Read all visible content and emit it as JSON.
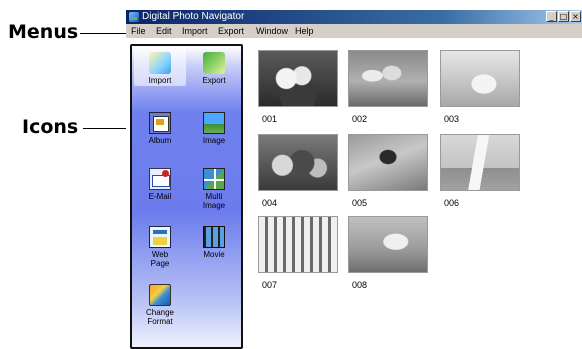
{
  "callouts": {
    "menus": "Menus",
    "icons": "Icons"
  },
  "window": {
    "title": "Digital Photo Navigator",
    "buttons": {
      "minimize": "_",
      "maximize": "□",
      "close": "×"
    }
  },
  "menubar": [
    {
      "label": "File"
    },
    {
      "label": "Edit"
    },
    {
      "label": "Import"
    },
    {
      "label": "Export"
    },
    {
      "label": "Window"
    },
    {
      "label": "Help"
    }
  ],
  "panel": {
    "items": [
      {
        "label": "Import",
        "icon": "import-icon"
      },
      {
        "label": "Export",
        "icon": "export-icon"
      },
      {
        "label": "Album",
        "icon": "album-icon"
      },
      {
        "label": "Image",
        "icon": "image-icon"
      },
      {
        "label": "E-Mail",
        "icon": "email-icon"
      },
      {
        "label": "Multi\nImage",
        "icon": "multi-image-icon"
      },
      {
        "label": "Web\nPage",
        "icon": "web-page-icon"
      },
      {
        "label": "Movie",
        "icon": "movie-icon"
      },
      {
        "label": "Change\nFormat",
        "icon": "change-format-icon"
      }
    ]
  },
  "thumbnails": [
    {
      "label": "001"
    },
    {
      "label": "002"
    },
    {
      "label": "003"
    },
    {
      "label": "004"
    },
    {
      "label": "005"
    },
    {
      "label": "006"
    },
    {
      "label": "007"
    },
    {
      "label": "008"
    }
  ]
}
